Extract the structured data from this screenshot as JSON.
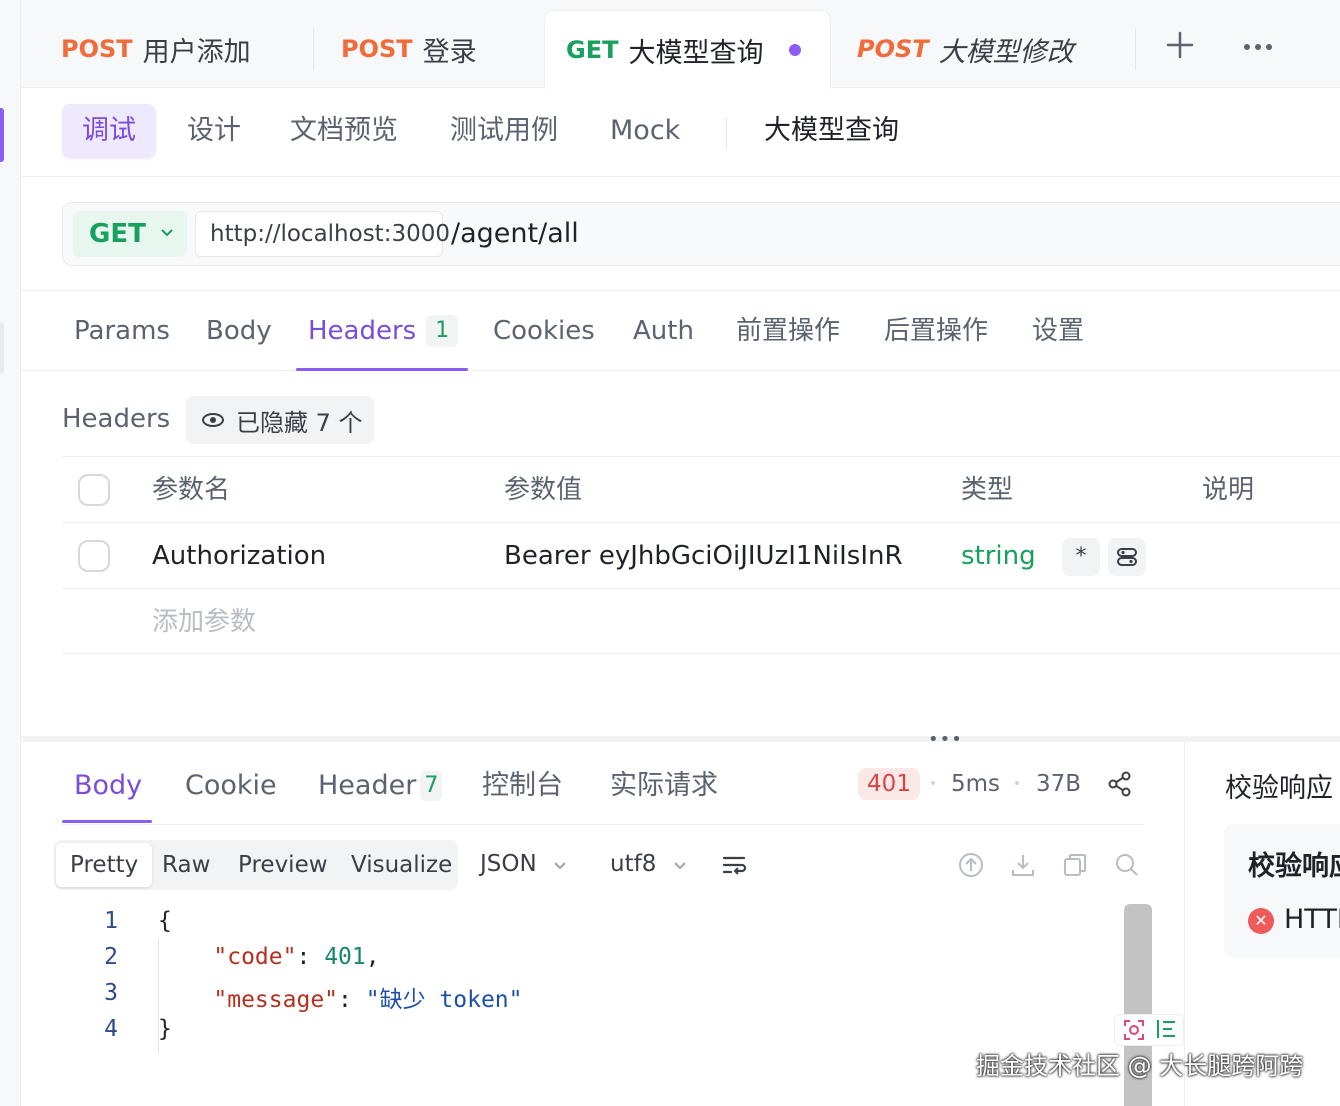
{
  "tabs": [
    {
      "method": "POST",
      "name": "用户添加"
    },
    {
      "method": "POST",
      "name": "登录"
    },
    {
      "method": "GET",
      "name": "大模型查询"
    },
    {
      "method": "POST",
      "name": "大模型修改"
    }
  ],
  "tab_actions": {
    "add_icon": "plus-icon",
    "more_icon": "more-icon"
  },
  "subnav": {
    "items": [
      "调试",
      "设计",
      "文档预览",
      "测试用例",
      "Mock"
    ],
    "active": "调试",
    "api_name": "大模型查询"
  },
  "request": {
    "method": "GET",
    "base_url": "http://localhost:3000",
    "path": "/agent/all"
  },
  "request_tabs": {
    "items": [
      "Params",
      "Body",
      "Headers",
      "Cookies",
      "Auth",
      "前置操作",
      "后置操作",
      "设置"
    ],
    "active": "Headers",
    "headers_count": "1"
  },
  "headers_section": {
    "label": "Headers",
    "hidden_text": "已隐藏 7 个",
    "columns": [
      "参数名",
      "参数值",
      "类型",
      "说明"
    ],
    "rows": [
      {
        "name": "Authorization",
        "value": "Bearer eyJhbGciOiJIUzI1NiIsInR",
        "type": "string",
        "required_marker": "*"
      }
    ],
    "add_placeholder": "添加参数"
  },
  "response": {
    "tabs": [
      "Body",
      "Cookie",
      "Header",
      "控制台",
      "实际请求"
    ],
    "active": "Body",
    "header_count": "7",
    "status": "401",
    "time": "5ms",
    "size": "37B",
    "view_modes": [
      "Pretty",
      "Raw",
      "Preview",
      "Visualize"
    ],
    "active_view": "Pretty",
    "format": "JSON",
    "encoding": "utf8",
    "code_lines": [
      "1",
      "2",
      "3",
      "4"
    ],
    "json_code_key": "\"code\"",
    "json_code_val": "401",
    "json_message_key": "\"message\"",
    "json_message_val": "\"缺少 token\""
  },
  "validation": {
    "title": "校验响应",
    "card_title": "校验响应",
    "card_text": "HTTP"
  },
  "watermark": "掘金技术社区 @ 大长腿跨阿跨",
  "colors": {
    "accent": "#8b5cf6",
    "get": "#17a05e",
    "post": "#f26b3a",
    "error": "#d94343"
  }
}
